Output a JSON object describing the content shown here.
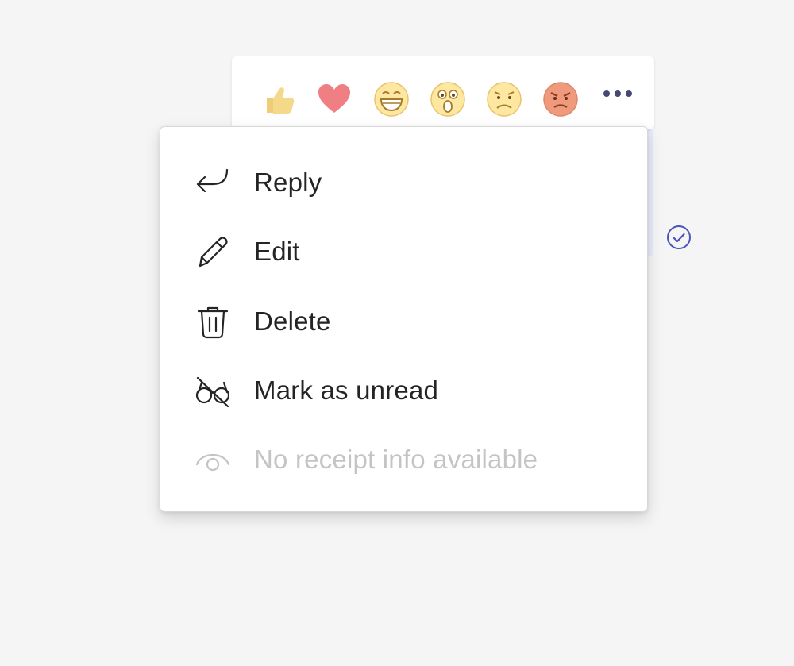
{
  "reactions": [
    {
      "icon": "thumbs-up-icon",
      "color": "#f5d98b"
    },
    {
      "icon": "heart-icon",
      "color": "#f07f84"
    },
    {
      "icon": "laughing-face-icon",
      "color": "#fde7a1"
    },
    {
      "icon": "surprised-face-icon",
      "color": "#fde7a1"
    },
    {
      "icon": "sad-face-icon",
      "color": "#fde7a1"
    },
    {
      "icon": "angry-face-icon",
      "color": "#ef9a7d"
    }
  ],
  "more_icon": "more-options-icon",
  "more_color": "#464775",
  "menu": {
    "items": [
      {
        "label": "Reply",
        "icon": "reply-arrow-icon",
        "enabled": true
      },
      {
        "label": "Edit",
        "icon": "pencil-icon",
        "enabled": true
      },
      {
        "label": "Delete",
        "icon": "trash-icon",
        "enabled": true
      },
      {
        "label": "Mark as unread",
        "icon": "glasses-off-icon",
        "enabled": true
      },
      {
        "label": "No receipt info available",
        "icon": "eye-icon",
        "enabled": false
      }
    ]
  },
  "status": {
    "icon": "sent-check-icon",
    "color": "#4b53bc"
  }
}
